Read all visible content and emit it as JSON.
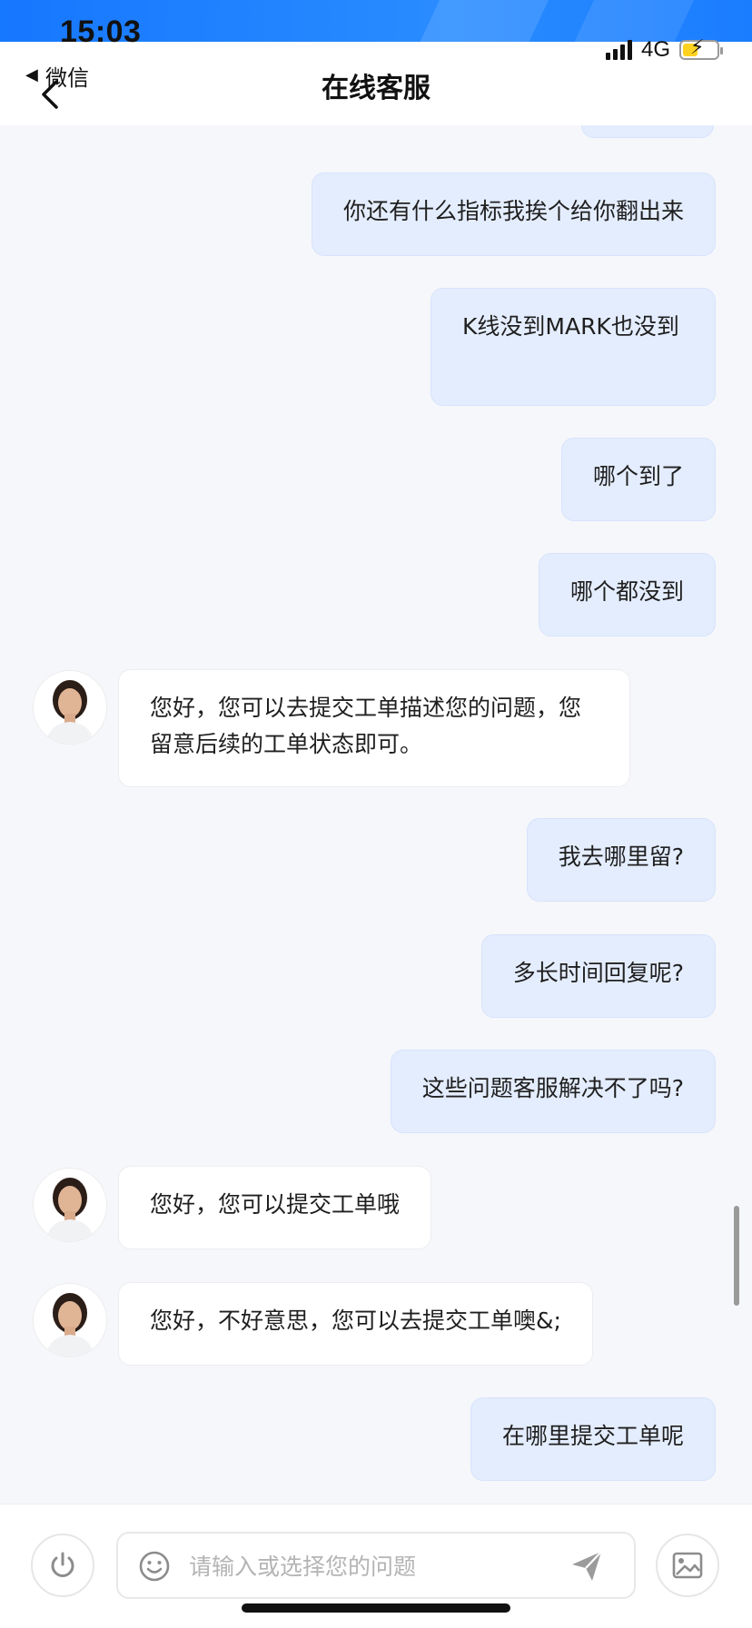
{
  "status_bar": {
    "time": "15:03",
    "network": "4G"
  },
  "header": {
    "back_label": "微信",
    "title": "在线客服"
  },
  "messages": [
    {
      "from": "user",
      "text": "你还有什么指标我挨个给你翻出来"
    },
    {
      "from": "user",
      "text": "K线没到MARK也没到"
    },
    {
      "from": "user",
      "text": "哪个到了"
    },
    {
      "from": "user",
      "text": "哪个都没到"
    },
    {
      "from": "agent",
      "text": "您好，您可以去提交工单描述您的问题，您留意后续的工单状态即可。"
    },
    {
      "from": "user",
      "text": "我去哪里留?"
    },
    {
      "from": "user",
      "text": "多长时间回复呢?"
    },
    {
      "from": "user",
      "text": "这些问题客服解决不了吗?"
    },
    {
      "from": "agent",
      "text": "您好，您可以提交工单哦"
    },
    {
      "from": "agent",
      "text": "您好，不好意思，您可以去提交工单噢&;"
    },
    {
      "from": "user",
      "text": "在哪里提交工单呢"
    }
  ],
  "input": {
    "placeholder": "请输入或选择您的问题",
    "value": ""
  },
  "colors": {
    "accent": "#1677ff",
    "user_bubble": "#e4edfe",
    "agent_bubble": "#ffffff",
    "background": "#f6f7fb"
  }
}
